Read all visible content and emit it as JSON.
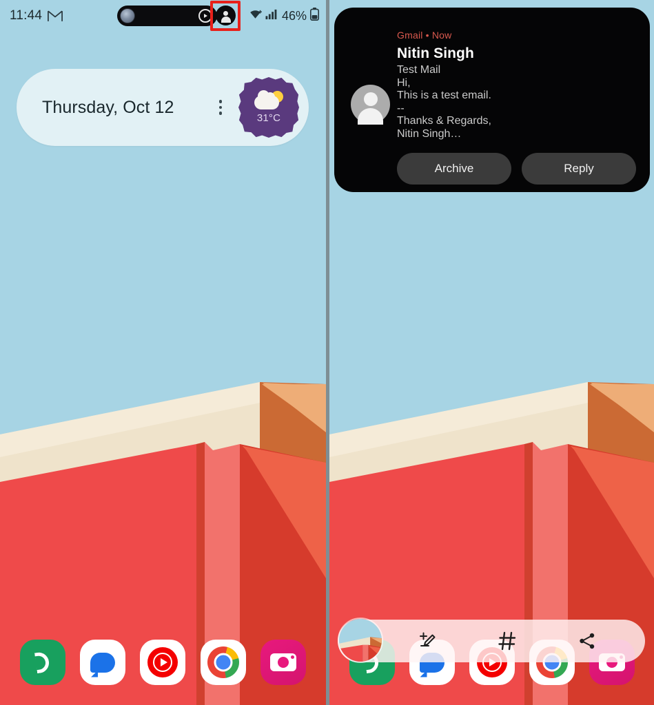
{
  "meta": {
    "panels": 2,
    "colors": {
      "sky": "#a7d4e4",
      "cream": "#efe3cb",
      "red_wall": "#ef4a4a",
      "dark_red": "#d0402f",
      "pink": "#f2726c",
      "orange_dark": "#cb6a34",
      "orange_light": "#eead77",
      "orange_red": "#ee6248",
      "notification_bg": "#050506",
      "gmail_accent": "#d9594e",
      "highlight_box": "#e8201a",
      "widget_bg": "#e2f1f5",
      "weather_blob": "#5a3a7e"
    }
  },
  "left_phone": {
    "status_bar": {
      "time": "11:44",
      "gmail_icon": "gmail-icon",
      "pill": {
        "avatar_icon": "contact-avatar-icon",
        "media_icon": "play-circle-icon"
      },
      "account_avatar_icon": "account-avatar-icon",
      "account_avatar_highlighted": true,
      "wifi_icon": "wifi-icon",
      "signal_icon": "cellular-signal-icon",
      "battery_percent": "46%",
      "battery_icon": "battery-icon"
    },
    "glance_widget": {
      "date": "Thursday, Oct 12",
      "overflow_icon": "kebab-menu-icon",
      "weather": {
        "condition_icon": "partly-cloudy-icon",
        "temperature": "31°C"
      }
    },
    "dock": [
      {
        "name": "phone-app-icon",
        "label": "Phone"
      },
      {
        "name": "messages-app-icon",
        "label": "Messages"
      },
      {
        "name": "youtube-music-app-icon",
        "label": "YouTube Music"
      },
      {
        "name": "chrome-app-icon",
        "label": "Chrome"
      },
      {
        "name": "camera-app-icon",
        "label": "Camera"
      }
    ]
  },
  "right_phone": {
    "notification": {
      "app_and_time": "Gmail • Now",
      "sender": "Nitin Singh",
      "subject": "Test Mail",
      "preview_lines": [
        "Hi,",
        "This is a test email.",
        "--",
        "Thanks & Regards,",
        "Nitin Singh…"
      ],
      "avatar_icon": "contact-avatar-icon",
      "actions": [
        {
          "name": "archive-action-button",
          "label": "Archive"
        },
        {
          "name": "reply-action-button",
          "label": "Reply"
        }
      ]
    },
    "screenshot_toolbar": {
      "thumbnail_icon": "screenshot-thumbnail",
      "buttons": [
        {
          "name": "edit-screenshot-button",
          "label": "Edit",
          "icon": "markup-edit-icon"
        },
        {
          "name": "add-tag-button",
          "label": "Tag",
          "icon": "hash-icon"
        },
        {
          "name": "share-screenshot-button",
          "label": "Share",
          "icon": "share-icon"
        }
      ]
    },
    "dock": [
      {
        "name": "phone-app-icon",
        "label": "Phone"
      },
      {
        "name": "messages-app-icon",
        "label": "Messages"
      },
      {
        "name": "youtube-music-app-icon",
        "label": "YouTube Music"
      },
      {
        "name": "chrome-app-icon",
        "label": "Chrome"
      },
      {
        "name": "camera-app-icon",
        "label": "Camera"
      }
    ]
  }
}
